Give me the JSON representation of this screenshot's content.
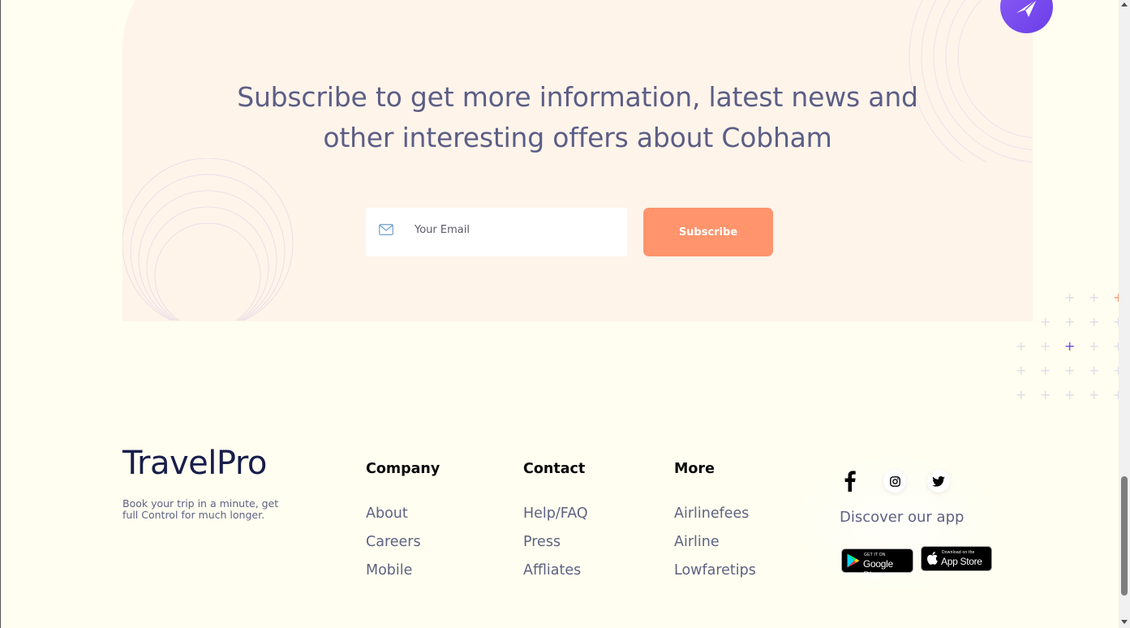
{
  "subscribe": {
    "title": "Subscribe to get more information, latest news and other interesting offers about Cobham",
    "email_placeholder": "Your Email",
    "button_label": "Subscribe"
  },
  "footer": {
    "brand": {
      "name": "TravelPro",
      "tagline": "Book your trip in a minute, get full Control for much longer."
    },
    "columns": [
      {
        "heading": "Company",
        "links": [
          "About",
          "Careers",
          "Mobile"
        ]
      },
      {
        "heading": "Contact",
        "links": [
          "Help/FAQ",
          "Press",
          "Affliates"
        ]
      },
      {
        "heading": "More",
        "links": [
          "Airlinefees",
          "Airline",
          "Lowfaretips"
        ]
      }
    ],
    "social": [
      "facebook-icon",
      "instagram-icon",
      "twitter-icon"
    ],
    "discover_app": "Discover our app",
    "stores": {
      "google": {
        "small": "GET IT ON",
        "big": "Google Play"
      },
      "apple": {
        "small": "Download on the",
        "big": "App Store"
      }
    }
  },
  "colors": {
    "page_background": "#fffef0",
    "card_background": "#fff4ea",
    "subscribe_button": "#ff946d",
    "heading_text": "#5b5e86",
    "brand_text": "#181e4b",
    "badge_purple": "#7b4cf0"
  }
}
